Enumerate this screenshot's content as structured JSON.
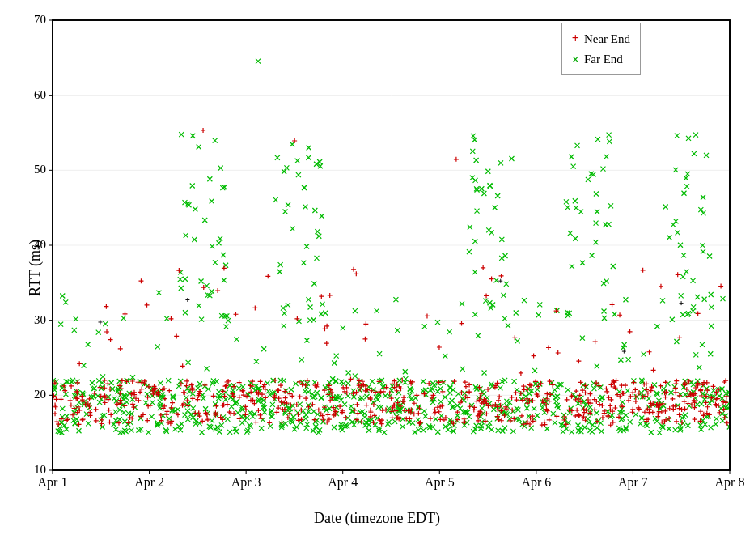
{
  "chart": {
    "title": "",
    "yAxis": {
      "label": "RTT (ms)",
      "min": 10,
      "max": 70,
      "ticks": [
        10,
        20,
        30,
        40,
        50,
        60,
        70
      ]
    },
    "xAxis": {
      "label": "Date (timezone EDT)",
      "ticks": [
        "Apr 1",
        "Apr 2",
        "Apr 3",
        "Apr 4",
        "Apr 5",
        "Apr 6",
        "Apr 7",
        "Apr 8"
      ]
    },
    "legend": {
      "nearEnd": {
        "label": "Near End",
        "color": "#cc0000",
        "symbol": "+"
      },
      "farEnd": {
        "label": "Far End",
        "color": "#00aa00",
        "symbol": "×"
      }
    }
  }
}
